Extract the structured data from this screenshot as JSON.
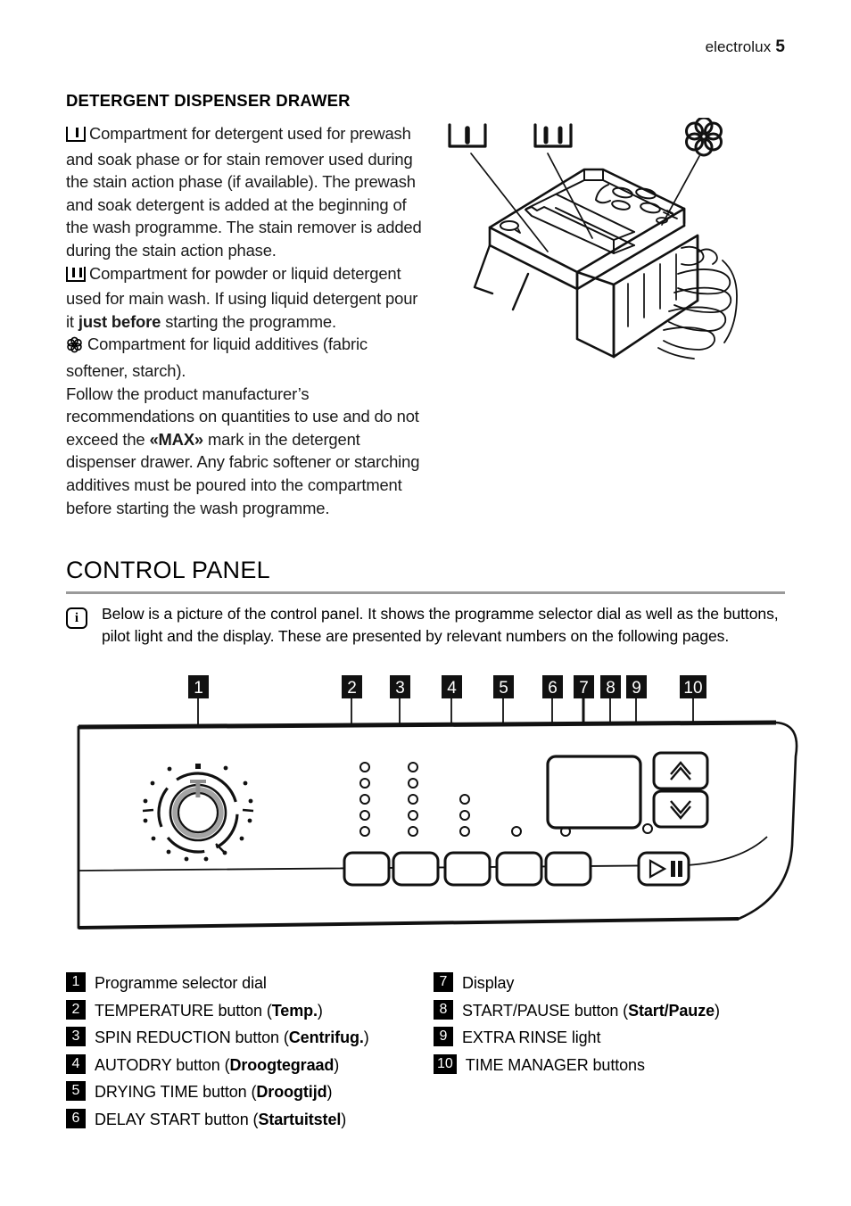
{
  "header": {
    "brand": "electrolux",
    "page_number": "5"
  },
  "detergent_section": {
    "heading": "DETERGENT DISPENSER DRAWER",
    "paragraphs": [
      {
        "symbol": "prewash-compartment-icon",
        "text": "Compartment for detergent used for prewash and soak phase or for stain remover used during the stain action phase (if available). The prewash and soak detergent is added at the beginning of the wash programme. The stain remover is added during the stain action phase."
      },
      {
        "symbol": "main-wash-compartment-icon",
        "text_before": "Compartment for powder or liquid detergent used for main wash. If using liquid detergent pour it ",
        "bold": "just before",
        "text_after": " starting the programme."
      },
      {
        "symbol": "softener-compartment-icon",
        "text": "Compartment for liquid additives (fabric softener, starch)."
      },
      {
        "symbol": "none",
        "text_before": "Follow the product manufacturer’s recommendations on quantities to use and do not exceed the ",
        "bold": "«MAX»",
        "text_after": " mark in the detergent dispenser drawer. Any fabric softener or starching additives must be poured into the compartment before starting the wash programme."
      }
    ],
    "figure": {
      "name": "detergent-drawer-illustration",
      "callouts": [
        "prewash-compartment-icon",
        "main-wash-compartment-icon",
        "softener-compartment-icon"
      ]
    }
  },
  "control_panel_section": {
    "heading": "CONTROL PANEL",
    "note": "Below is a picture of the control panel. It shows the programme selector dial as well as the buttons, pilot light and the display. These are presented by relevant numbers on the following pages.",
    "note_icon": "info-icon",
    "figure_name": "control-panel-illustration",
    "callout_numbers": [
      "1",
      "2",
      "3",
      "4",
      "5",
      "6",
      "7",
      "8",
      "9",
      "10"
    ],
    "legend_left": [
      {
        "num": "1",
        "text": "Programme selector dial",
        "bold": ""
      },
      {
        "num": "2",
        "text_before": "TEMPERATURE button (",
        "bold": "Temp.",
        "text_after": ")"
      },
      {
        "num": "3",
        "text_before": "SPIN REDUCTION button (",
        "bold": "Centrifug.",
        "text_after": ")"
      },
      {
        "num": "4",
        "text_before": "AUTODRY button (",
        "bold": "Droogtegraad",
        "text_after": ")"
      },
      {
        "num": "5",
        "text_before": "DRYING TIME button (",
        "bold": "Droogtijd",
        "text_after": ")"
      },
      {
        "num": "6",
        "text_before": "DELAY START button (",
        "bold": "Startuitstel",
        "text_after": ")"
      }
    ],
    "legend_right": [
      {
        "num": "7",
        "text": "Display",
        "bold": ""
      },
      {
        "num": "8",
        "text_before": "START/PAUSE button (",
        "bold": "Start/Pauze",
        "text_after": ")"
      },
      {
        "num": "9",
        "text": "EXTRA RINSE light",
        "bold": ""
      },
      {
        "num": "10",
        "text": "TIME MANAGER buttons",
        "bold": ""
      }
    ],
    "panel_controls": {
      "dial": "programme-selector-dial",
      "button_led_counts": [
        5,
        5,
        3,
        1,
        1
      ],
      "display": "display-screen",
      "start_pause": "start-pause-button",
      "extra_rinse_light": "extra-rinse-light",
      "time_manager_up": "time-manager-up-button",
      "time_manager_down": "time-manager-down-button"
    }
  },
  "colors": {
    "rule": "#9a9a9a",
    "ink": "#000000",
    "paper": "#ffffff"
  }
}
